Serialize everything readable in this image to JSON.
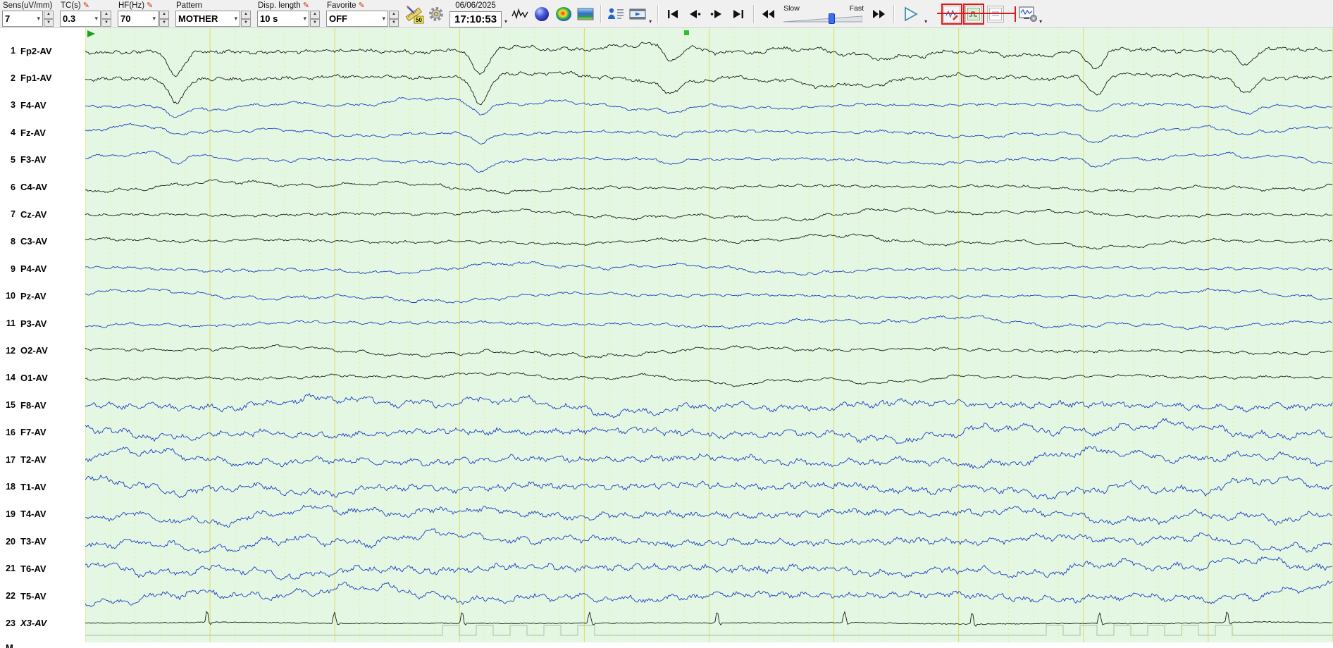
{
  "toolbar": {
    "controls": [
      {
        "id": "sens",
        "label": "Sens(uV/mm)",
        "value": "7",
        "pencil": false
      },
      {
        "id": "tc",
        "label": "TC(s)",
        "value": "0.3",
        "pencil": true
      },
      {
        "id": "hf",
        "label": "HF(Hz)",
        "value": "70",
        "pencil": true
      },
      {
        "id": "pattern",
        "label": "Pattern",
        "value": "MOTHER",
        "pencil": false
      },
      {
        "id": "disp",
        "label": "Disp. length",
        "value": "10 s",
        "pencil": true
      },
      {
        "id": "favorite",
        "label": "Favorite",
        "value": "OFF",
        "pencil": true
      }
    ],
    "measure_value": "50",
    "date": "06/06/2025",
    "time": "17:10:53",
    "slider": {
      "left_label": "Slow",
      "right_label": "Fast",
      "position": 0.62
    }
  },
  "display": {
    "seconds": 10,
    "minor_per_second": 5,
    "bg": "#e3f7e3",
    "grid_major": "#dedc60",
    "grid_minor": "#ebeb95",
    "trace_blue": "#1c3ec2",
    "trace_black": "#1a1a1a",
    "event_trace": "#b9c7ae",
    "marker_green": "#1f9f1f"
  },
  "channels": [
    {
      "num": "1",
      "label": "Fp2-AV",
      "color": "black",
      "kind": "frontal"
    },
    {
      "num": "2",
      "label": "Fp1-AV",
      "color": "black",
      "kind": "frontal"
    },
    {
      "num": "3",
      "label": "F4-AV",
      "color": "blue",
      "kind": "eeg",
      "blink_scale": 0.35
    },
    {
      "num": "4",
      "label": "Fz-AV",
      "color": "blue",
      "kind": "eeg",
      "blink_scale": 0.3
    },
    {
      "num": "5",
      "label": "F3-AV",
      "color": "blue",
      "kind": "eeg",
      "blink_scale": 0.35
    },
    {
      "num": "6",
      "label": "C4-AV",
      "color": "black",
      "kind": "eeg"
    },
    {
      "num": "7",
      "label": "Cz-AV",
      "color": "black",
      "kind": "eeg"
    },
    {
      "num": "8",
      "label": "C3-AV",
      "color": "black",
      "kind": "eeg"
    },
    {
      "num": "9",
      "label": "P4-AV",
      "color": "blue",
      "kind": "eeg"
    },
    {
      "num": "10",
      "label": "Pz-AV",
      "color": "blue",
      "kind": "eeg"
    },
    {
      "num": "11",
      "label": "P3-AV",
      "color": "blue",
      "kind": "eeg"
    },
    {
      "num": "12",
      "label": "O2-AV",
      "color": "black",
      "kind": "eeg"
    },
    {
      "num": "14",
      "label": "O1-AV",
      "color": "black",
      "kind": "eeg"
    },
    {
      "num": "15",
      "label": "F8-AV",
      "color": "blue",
      "kind": "temporal"
    },
    {
      "num": "16",
      "label": "F7-AV",
      "color": "blue",
      "kind": "temporal"
    },
    {
      "num": "17",
      "label": "T2-AV",
      "color": "blue",
      "kind": "temporal"
    },
    {
      "num": "18",
      "label": "T1-AV",
      "color": "blue",
      "kind": "temporal"
    },
    {
      "num": "19",
      "label": "T4-AV",
      "color": "blue",
      "kind": "temporal"
    },
    {
      "num": "20",
      "label": "T3-AV",
      "color": "blue",
      "kind": "temporal"
    },
    {
      "num": "21",
      "label": "T6-AV",
      "color": "blue",
      "kind": "temporal"
    },
    {
      "num": "22",
      "label": "T5-AV",
      "color": "blue",
      "kind": "temporal"
    },
    {
      "num": "23",
      "label": "X3-AV",
      "color": "black",
      "kind": "ecg",
      "italic": true
    }
  ],
  "bottom_marker": "M"
}
